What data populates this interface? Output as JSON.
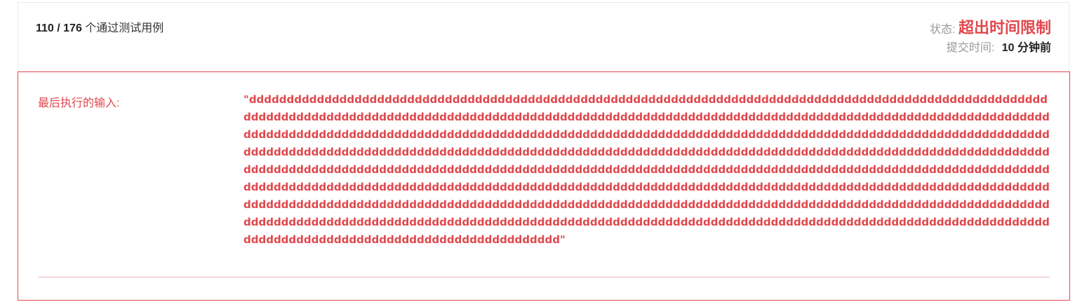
{
  "result": {
    "passed_count": "110 / 176",
    "passed_suffix": "个通过测试用例",
    "status_label": "状态:",
    "status_value": "超出时间限制",
    "submitted_label": "提交时间:",
    "submitted_value": "10 分钟前"
  },
  "error": {
    "last_input_label": "最后执行的输入:",
    "last_input_value": "\"ddddddddddddddddddddddddddddddddddddddddddddddddddddddddddddddddddddddddddddddddddddddddddddddddddddddddddddddddddddddddddddddddddddddddddddddddddddddddddddddddddddddddddddddddddddddddddddddddddddddddddddddddddddddddddddddddddddddddddddddddddddddddddddddddddddddddddddddddddddddddddddddddddddddddddddddddddddddddddddddddddddddddddddddddddddddddddddddddddddddddddddddddddddddddddddddddddddddddddddddddddddddddddddddddddddddddddddddddddddddddddddddddddddddddddddddddddddddddddddddddddddddddddddddddddddddddddddddddddddddddddddddddddddddddddddddddddddddddddddddddddddddddddddddddddddddddddddddddddddddddddddddddddddddddddddddddddddddddddddddddddddddddddddddddddddddddddddddddddddddddddddddddddddddddddddddddddddddddddddddddddddddddddddddddddddddddddddddddddddddddddddddddddddddddddddddddddddddddddddddddddddddddddddddddddddddddddddddddddddddddddddddddddddddddddddddddddddddddddddddddddddddddddddddddd\""
  }
}
